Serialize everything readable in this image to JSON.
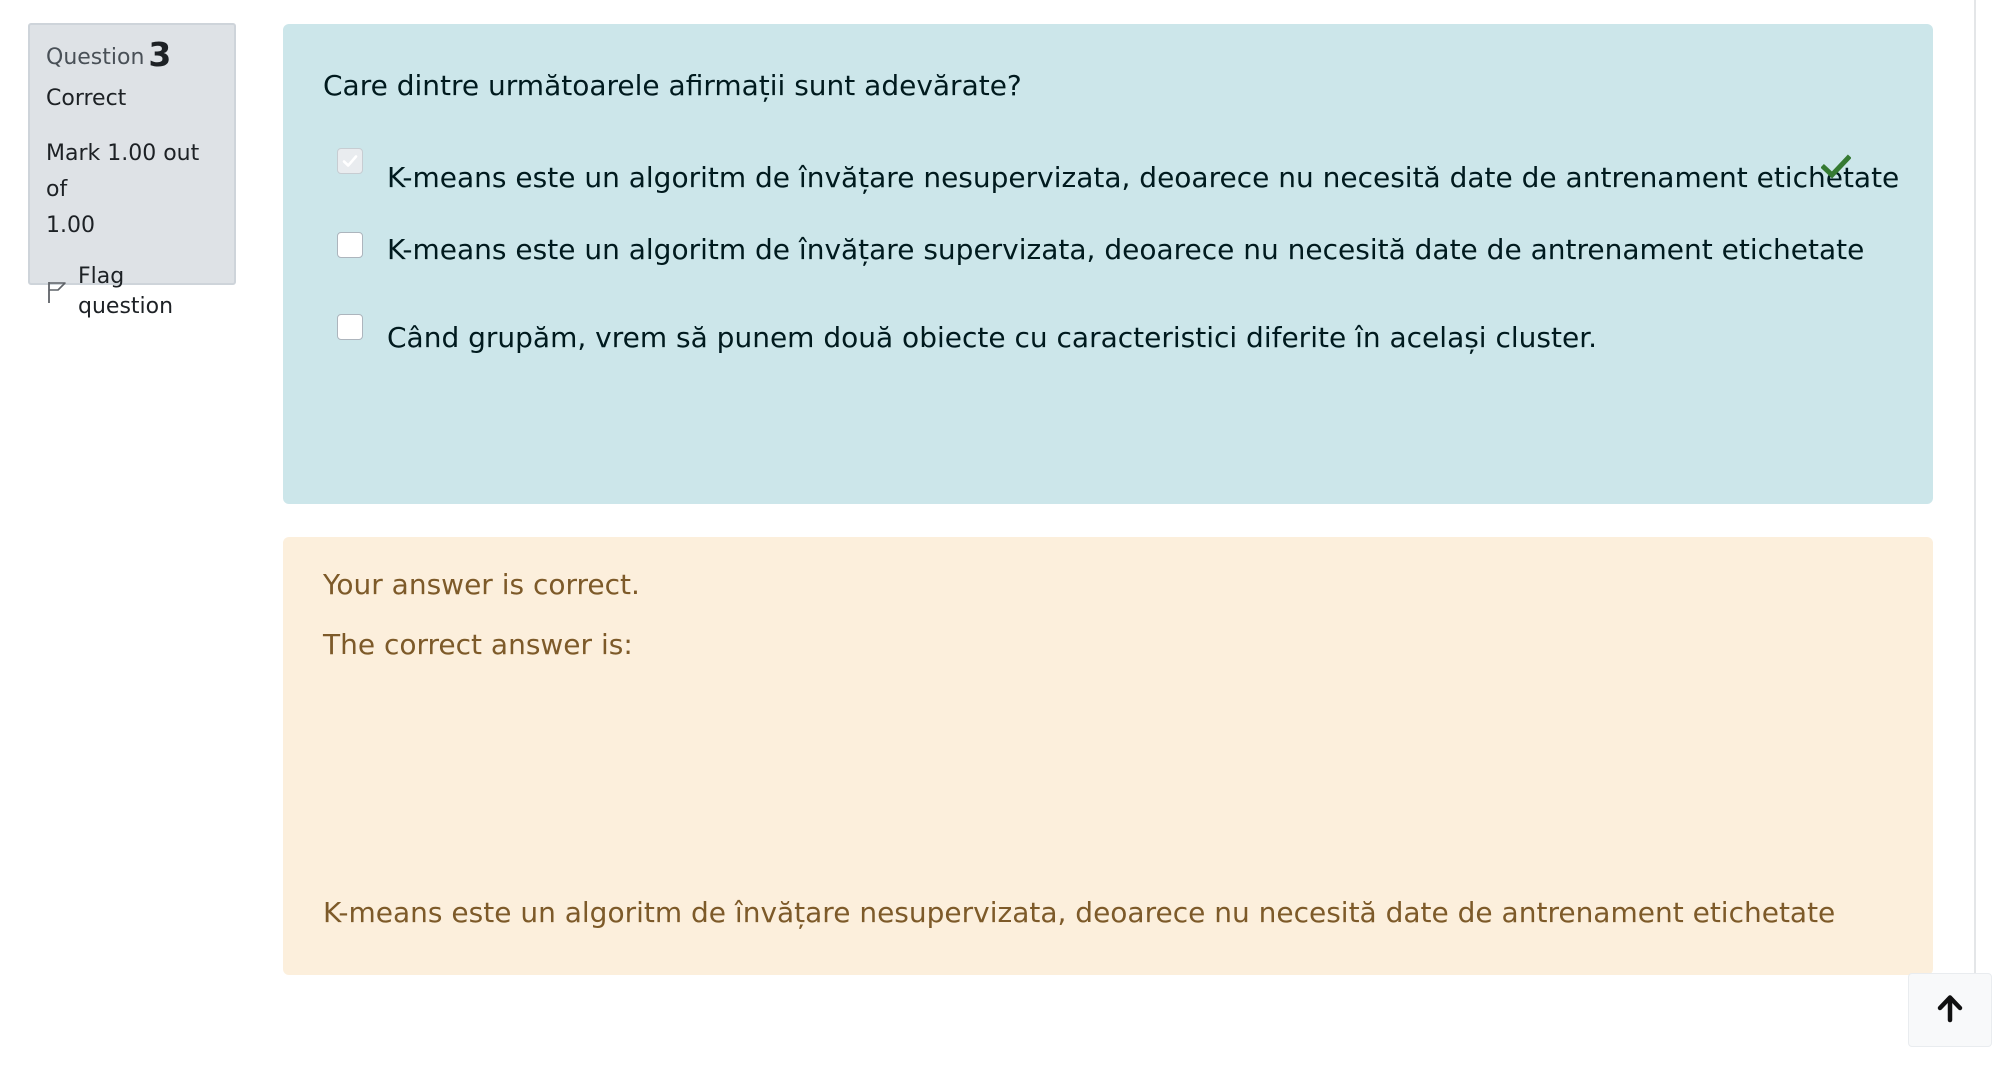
{
  "question_info": {
    "prefix": "Question",
    "number": "3",
    "state": "Correct",
    "grade_line1": "Mark 1.00 out of",
    "grade_line2": "1.00",
    "flag_label": "Flag question"
  },
  "formulation": {
    "question_text": "Care dintre următoarele afirmații sunt adevărate?",
    "answers": [
      {
        "label": "K-means este un algoritm de învățare nesupervizata, deoarece nu necesită date de antrenament etichetate",
        "checked": true,
        "correct": true
      },
      {
        "label": "K-means este un algoritm de învățare supervizata, deoarece nu necesită date de antrenament etichetate",
        "checked": false
      },
      {
        "label": "Când grupăm, vrem să punem două obiecte cu caracteristici diferite în același cluster.",
        "checked": false
      }
    ]
  },
  "outcome": {
    "feedback": "Your answer is correct.",
    "right_answer_intro": "The correct answer is:",
    "right_answer": "K-means este un algoritm de învățare nesupervizata, deoarece nu necesită date de antrenament etichetate"
  },
  "icons": {
    "correct": "check-icon",
    "flag": "flag-icon",
    "back_to_top": "arrow-up-icon"
  },
  "colors": {
    "formulation_bg": "#cce6ea",
    "outcome_bg": "#fcefdc",
    "correct_green": "#357a32",
    "info_bg": "#dee2e6"
  }
}
